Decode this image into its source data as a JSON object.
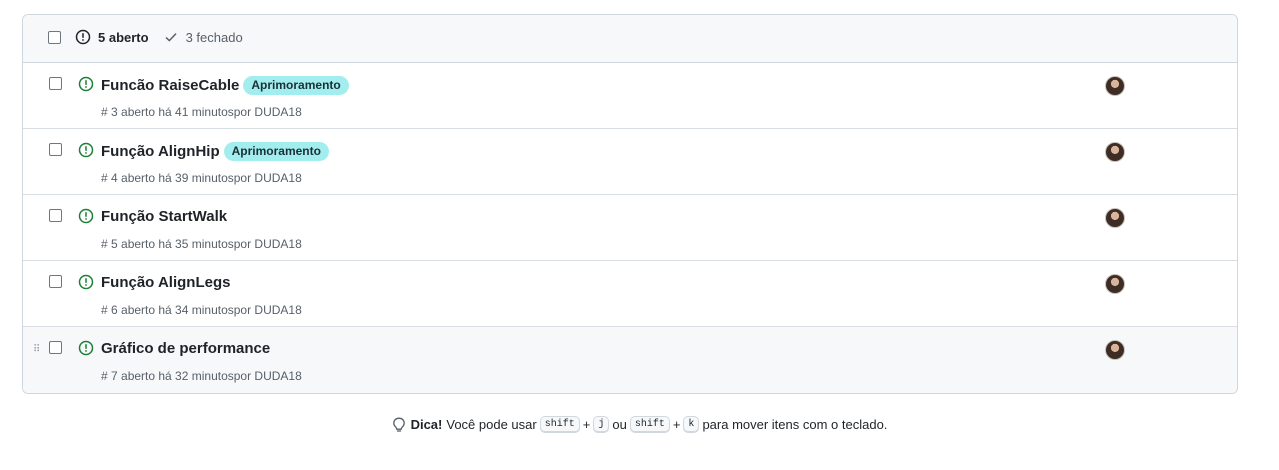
{
  "header": {
    "open_label": "5 aberto",
    "closed_label": "3 fechado"
  },
  "issues": [
    {
      "title": "Funcão RaiseCable",
      "label": "Aprimoramento",
      "meta": "# 3 aberto há 41 minutospor DUDA18"
    },
    {
      "title": "Função AlignHip",
      "label": "Aprimoramento",
      "meta": "# 4 aberto há 39 minutospor DUDA18"
    },
    {
      "title": "Função StartWalk",
      "label": "",
      "meta": "# 5 aberto há 35 minutospor DUDA18"
    },
    {
      "title": "Função AlignLegs",
      "label": "",
      "meta": "# 6 aberto há 34 minutospor DUDA18"
    },
    {
      "title": "Gráfico de performance",
      "label": "",
      "meta": "# 7 aberto há 32 minutospor DUDA18"
    }
  ],
  "tip": {
    "bold": "Dica!",
    "text1": "Você pode usar",
    "key1": "shift",
    "plus1": "+",
    "key2": "j",
    "or": "ou",
    "key3": "shift",
    "plus2": "+",
    "key4": "k",
    "text2": "para mover itens com o teclado."
  },
  "colors": {
    "open_icon": "#1a7f37",
    "label_bg": "#a2eeef",
    "border": "#d0d7de"
  }
}
